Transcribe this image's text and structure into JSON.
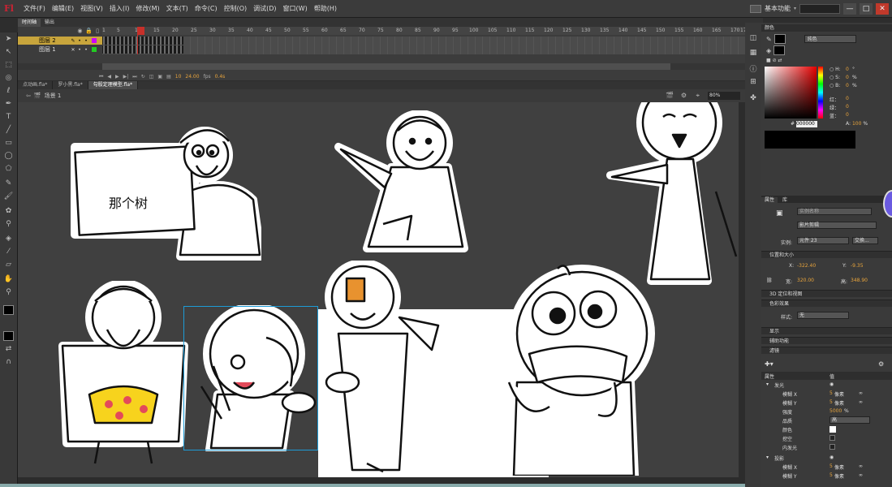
{
  "app": {
    "logo": "Fl",
    "workspace": "基本功能",
    "search_placeholder": ""
  },
  "menu": [
    "文件(F)",
    "编辑(E)",
    "视图(V)",
    "插入(I)",
    "修改(M)",
    "文本(T)",
    "命令(C)",
    "控制(O)",
    "调试(D)",
    "窗口(W)",
    "帮助(H)"
  ],
  "panel_tabs": [
    "时间轴",
    "输出"
  ],
  "timeline": {
    "layers": [
      {
        "name": "图层 2"
      },
      {
        "name": "图层 1"
      }
    ],
    "ruler": [
      "1",
      "5",
      "10",
      "15",
      "20",
      "25",
      "30",
      "35",
      "40",
      "45",
      "50",
      "55",
      "60",
      "65",
      "70",
      "75",
      "80",
      "85",
      "90",
      "95",
      "100",
      "105",
      "110",
      "115",
      "120",
      "125",
      "130",
      "135",
      "140",
      "145",
      "150",
      "155",
      "160",
      "165",
      "170",
      "17"
    ],
    "current_frame": "10",
    "fps": "24.00",
    "fps_unit": "fps",
    "seconds": "0.4s"
  },
  "doc_tabs": [
    "点动画.fla*",
    "罗小黑.fla*",
    "勾股定理模型.fla*"
  ],
  "scene": {
    "label": "场景 1",
    "zoom": "80%"
  },
  "stage": {
    "sign_text": "那个树"
  },
  "color_panel": {
    "title": "颜色",
    "fill_type": "纯色",
    "h": "0",
    "h_unit": "°",
    "s": "0",
    "s_unit": "%",
    "b": "0",
    "b_unit": "%",
    "r_label": "红：",
    "r": "0",
    "g_label": "绿：",
    "g": "0",
    "b_label": "蓝：",
    "bl": "0",
    "hex_label": "#",
    "hex": "000000",
    "alpha_label": "A:",
    "alpha": "100",
    "alpha_unit": "%"
  },
  "properties": {
    "tabs": [
      "属性",
      "库"
    ],
    "instance_name_placeholder": "实例名称",
    "symbol_type": "影片剪辑",
    "instance_label": "实例:",
    "instance_value": "元件 23",
    "swap_label": "交换...",
    "pos_section": "位置和大小",
    "x_label": "X:",
    "x": "-322.40",
    "y_label": "Y:",
    "y": "-9.35",
    "w_label": "宽:",
    "w": "320.00",
    "h_label": "高:",
    "h": "348.90",
    "sec_3d": "3D 定位和视图",
    "sec_color": "色彩效果",
    "style_label": "样式:",
    "style_value": "无",
    "sec_display": "显示",
    "sec_access": "辅助功能",
    "sec_filters": "滤镜",
    "filter_col_prop": "属性",
    "filter_col_val": "值",
    "filters": [
      {
        "name": "发光",
        "rows": [
          {
            "label": "模糊 X",
            "value": "5",
            "unit": "像素"
          },
          {
            "label": "模糊 Y",
            "value": "5",
            "unit": "像素"
          },
          {
            "label": "强度",
            "value": "5000",
            "unit": "%"
          },
          {
            "label": "品质",
            "value": "高",
            "unit": ""
          },
          {
            "label": "颜色",
            "value": "",
            "unit": ""
          },
          {
            "label": "挖空",
            "value": "",
            "unit": ""
          },
          {
            "label": "内发光",
            "value": "",
            "unit": ""
          }
        ]
      },
      {
        "name": "投影",
        "rows": [
          {
            "label": "模糊 X",
            "value": "5",
            "unit": "像素"
          },
          {
            "label": "模糊 Y",
            "value": "5",
            "unit": "像素"
          }
        ]
      }
    ]
  }
}
